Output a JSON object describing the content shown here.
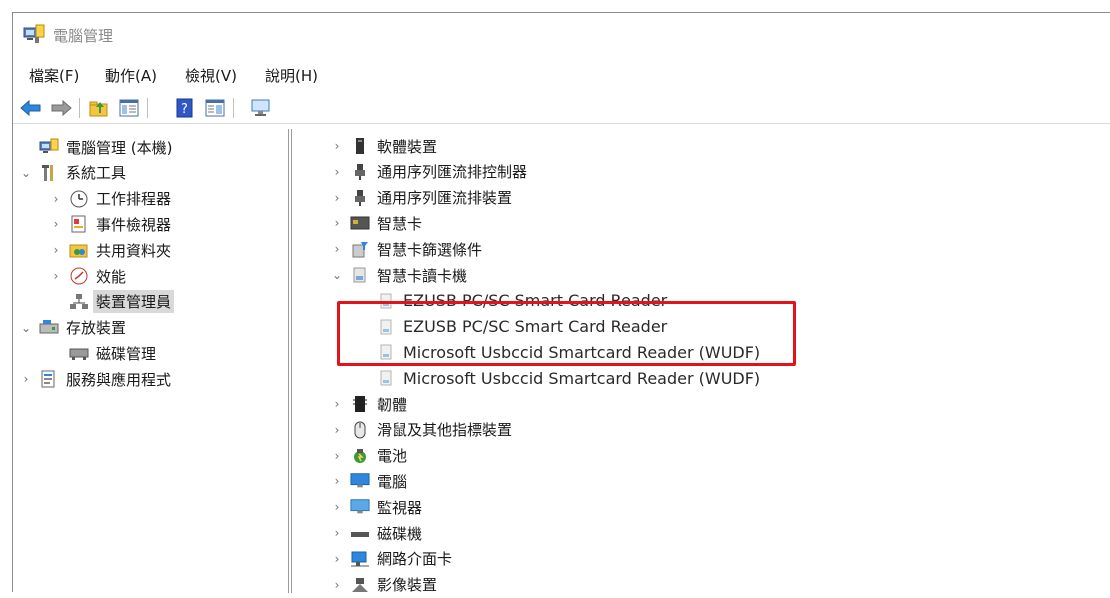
{
  "window": {
    "title": "電腦管理"
  },
  "menubar": [
    {
      "label": "檔案(F)"
    },
    {
      "label": "動作(A)"
    },
    {
      "label": "檢視(V)"
    },
    {
      "label": "說明(H)"
    }
  ],
  "toolbar": {
    "buttons": [
      "back-arrow-icon",
      "forward-arrow-icon",
      "folder-up-icon",
      "show-hide-tree-icon",
      "help-icon",
      "properties-icon",
      "monitor-icon"
    ]
  },
  "left_tree": [
    {
      "label": "電腦管理 (本機)",
      "chevron": "",
      "icon": "computer-management-icon",
      "indent": 0
    },
    {
      "label": "系統工具",
      "chevron": "⌄",
      "icon": "tools-icon",
      "indent": 0
    },
    {
      "label": "工作排程器",
      "chevron": "›",
      "icon": "clock-icon",
      "indent": 1
    },
    {
      "label": "事件檢視器",
      "chevron": "›",
      "icon": "event-viewer-icon",
      "indent": 1
    },
    {
      "label": "共用資料夾",
      "chevron": "›",
      "icon": "shared-folder-icon",
      "indent": 1
    },
    {
      "label": "效能",
      "chevron": "›",
      "icon": "performance-icon",
      "indent": 1
    },
    {
      "label": "裝置管理員",
      "chevron": "",
      "icon": "device-manager-icon",
      "indent": 1,
      "selected": true
    },
    {
      "label": "存放裝置",
      "chevron": "⌄",
      "icon": "storage-icon",
      "indent": 0
    },
    {
      "label": "磁碟管理",
      "chevron": "",
      "icon": "disk-management-icon",
      "indent": 1
    },
    {
      "label": "服務與應用程式",
      "chevron": "›",
      "icon": "services-icon",
      "indent": 0
    }
  ],
  "right_tree": [
    {
      "label": "軟體裝置",
      "chevron": "›",
      "icon": "software-device-icon",
      "indent": 0
    },
    {
      "label": "通用序列匯流排控制器",
      "chevron": "›",
      "icon": "usb-controller-icon",
      "indent": 0
    },
    {
      "label": "通用序列匯流排裝置",
      "chevron": "›",
      "icon": "usb-device-icon",
      "indent": 0
    },
    {
      "label": "智慧卡",
      "chevron": "›",
      "icon": "smart-card-icon",
      "indent": 0
    },
    {
      "label": "智慧卡篩選條件",
      "chevron": "›",
      "icon": "smart-card-filter-icon",
      "indent": 0
    },
    {
      "label": "智慧卡讀卡機",
      "chevron": "⌄",
      "icon": "card-reader-icon",
      "indent": 0
    },
    {
      "label": "EZUSB PC/SC Smart Card Reader",
      "chevron": "",
      "icon": "card-reader-device-icon",
      "indent": 1,
      "en": true
    },
    {
      "label": "EZUSB PC/SC Smart Card Reader",
      "chevron": "",
      "icon": "card-reader-device-icon",
      "indent": 1,
      "en": true
    },
    {
      "label": "Microsoft Usbccid Smartcard Reader (WUDF)",
      "chevron": "",
      "icon": "card-reader-device-icon",
      "indent": 1,
      "en": true
    },
    {
      "label": "Microsoft Usbccid Smartcard Reader (WUDF)",
      "chevron": "",
      "icon": "card-reader-device-icon",
      "indent": 1,
      "en": true
    },
    {
      "label": "韌體",
      "chevron": "›",
      "icon": "firmware-icon",
      "indent": 0
    },
    {
      "label": "滑鼠及其他指標裝置",
      "chevron": "›",
      "icon": "mouse-icon",
      "indent": 0
    },
    {
      "label": "電池",
      "chevron": "›",
      "icon": "battery-icon",
      "indent": 0
    },
    {
      "label": "電腦",
      "chevron": "›",
      "icon": "computer-icon",
      "indent": 0
    },
    {
      "label": "監視器",
      "chevron": "›",
      "icon": "monitor-icon",
      "indent": 0
    },
    {
      "label": "磁碟機",
      "chevron": "›",
      "icon": "disk-drive-icon",
      "indent": 0
    },
    {
      "label": "網路介面卡",
      "chevron": "›",
      "icon": "network-adapter-icon",
      "indent": 0
    },
    {
      "label": "影像裝置",
      "chevron": "›",
      "icon": "imaging-device-icon",
      "indent": 0
    }
  ],
  "colors": {
    "highlight_box": "#e4121a",
    "selected_bg": "#d9d9d9"
  }
}
